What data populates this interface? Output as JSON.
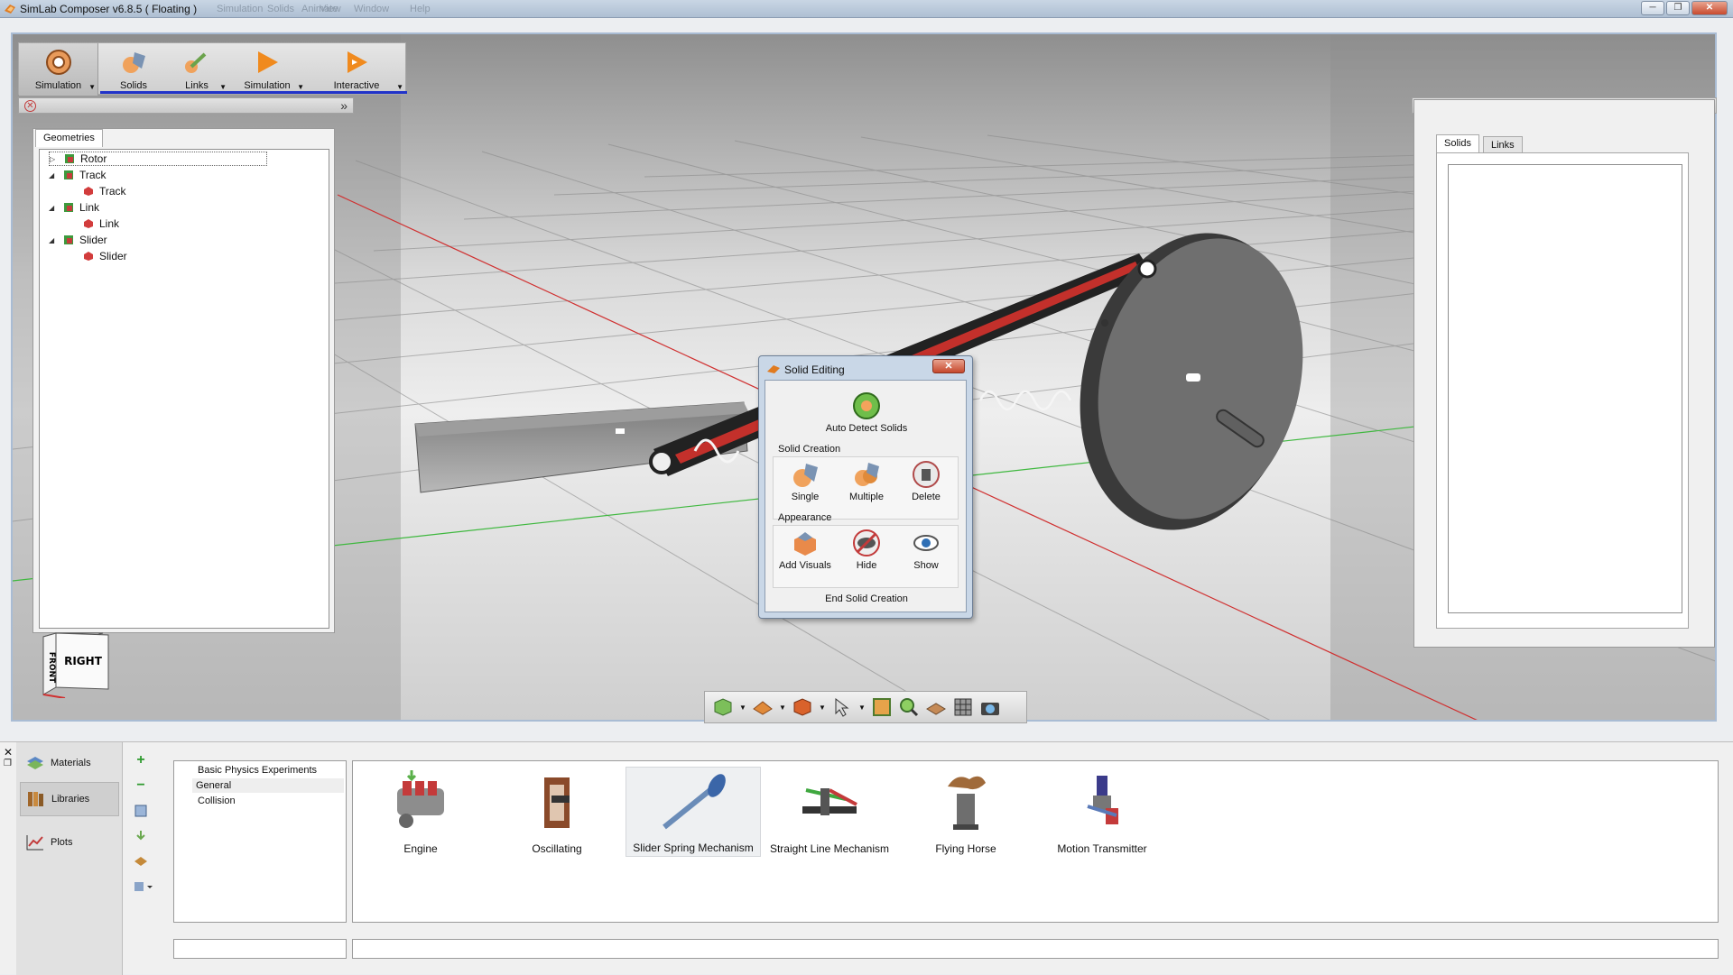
{
  "window": {
    "title": "SimLab Composer v6.8.5 ( Floating )",
    "ghost_menu": [
      "Simulation",
      "Solids",
      "Animate",
      "View",
      "Window",
      "Help"
    ],
    "controls": [
      "─",
      "❐",
      "✕"
    ]
  },
  "ribbon": {
    "buttons": [
      {
        "label": "Simulation",
        "icon": "simulation-gear-icon"
      },
      {
        "label": "Solids",
        "icon": "solids-icon"
      },
      {
        "label": "Links",
        "icon": "links-icon"
      },
      {
        "label": "Simulation",
        "icon": "play-icon"
      },
      {
        "label": "Interactive",
        "icon": "interactive-play-icon"
      }
    ],
    "accent": "#2133c9"
  },
  "geometries_panel": {
    "tab": "Geometries",
    "tree": [
      {
        "label": "Rotor",
        "level": 0,
        "expander": "▷",
        "selected": true
      },
      {
        "label": "Track",
        "level": 0,
        "expander": "◢"
      },
      {
        "label": "Track",
        "level": 1
      },
      {
        "label": "Link",
        "level": 0,
        "expander": "◢"
      },
      {
        "label": "Link",
        "level": 1
      },
      {
        "label": "Slider",
        "level": 0,
        "expander": "◢"
      },
      {
        "label": "Slider",
        "level": 1
      }
    ]
  },
  "right_panel": {
    "tabs": [
      "Solids",
      "Links"
    ]
  },
  "viewcube": {
    "front": "FRONT",
    "right": "RIGHT"
  },
  "dialog": {
    "title": "Solid Editing",
    "close": "✕",
    "auto_detect": "Auto Detect Solids",
    "solid_creation_header": "Solid Creation",
    "single": "Single",
    "multiple": "Multiple",
    "delete": "Delete",
    "appearance_header": "Appearance",
    "add_visuals": "Add Visuals",
    "hide": "Hide",
    "show": "Show",
    "end": "End Solid Creation"
  },
  "bottom": {
    "sidebar": [
      {
        "label": "Materials",
        "icon": "materials-icon"
      },
      {
        "label": "Libraries",
        "icon": "libraries-icon",
        "selected": true
      },
      {
        "label": "Plots",
        "icon": "plots-icon"
      }
    ],
    "categories": [
      {
        "label": "Basic Physics Experiments"
      },
      {
        "label": "General",
        "selected": true
      },
      {
        "label": "Collision"
      }
    ],
    "library_items": [
      {
        "label": "Engine"
      },
      {
        "label": "Oscillating"
      },
      {
        "label": "Slider Spring Mechanism",
        "selected": true
      },
      {
        "label": "Straight Line Mechanism"
      },
      {
        "label": "Flying Horse"
      },
      {
        "label": "Motion Transmitter"
      }
    ]
  }
}
